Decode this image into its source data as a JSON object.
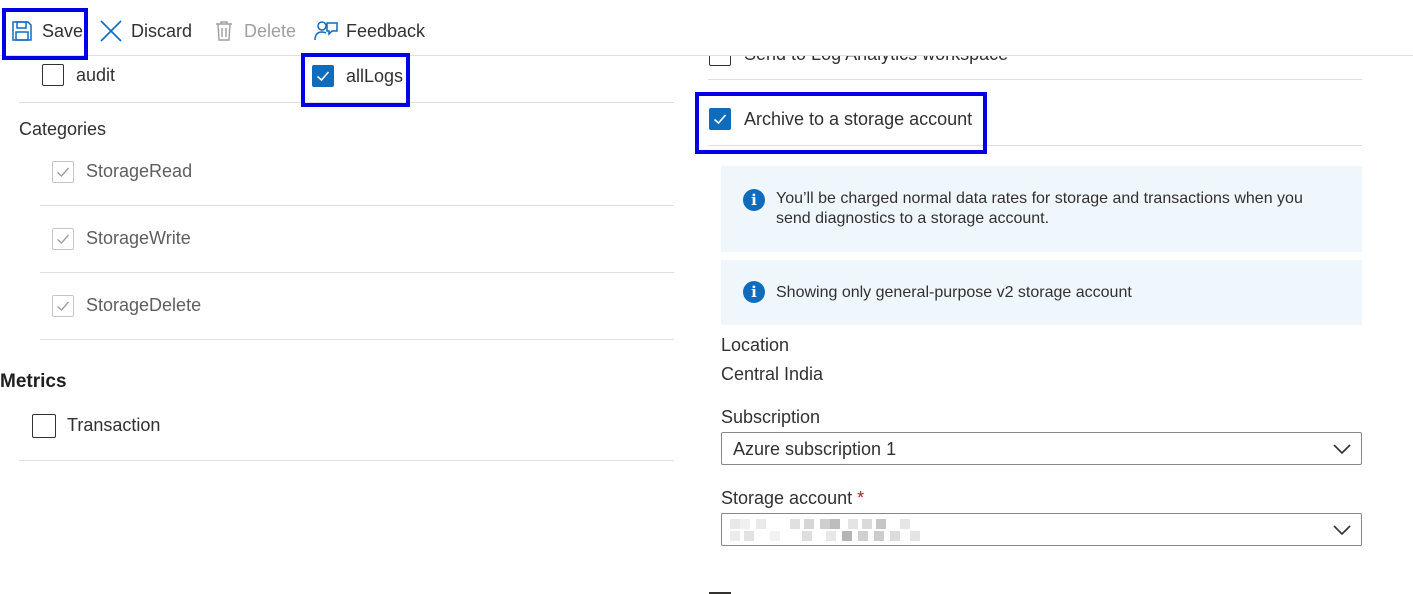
{
  "toolbar": {
    "save_label": "Save",
    "discard_label": "Discard",
    "delete_label": "Delete",
    "feedback_label": "Feedback"
  },
  "logs": {
    "categorygroups": [
      {
        "label": "audit",
        "checked": false
      },
      {
        "label": "allLogs",
        "checked": true
      }
    ],
    "categories_title": "Categories",
    "categories": [
      {
        "label": "StorageRead",
        "checked": true,
        "disabled": true
      },
      {
        "label": "StorageWrite",
        "checked": true,
        "disabled": true
      },
      {
        "label": "StorageDelete",
        "checked": true,
        "disabled": true
      }
    ]
  },
  "metrics": {
    "title": "Metrics",
    "items": [
      {
        "label": "Transaction",
        "checked": false
      }
    ]
  },
  "destinations": {
    "log_analytics_label": "Send to Log Analytics workspace",
    "archive_label": "Archive to a storage account",
    "info_charge": "You’ll be charged normal data rates for storage and transactions when you send diagnostics to a storage account.",
    "info_general_purpose": "Showing only general-purpose v2 storage account",
    "location_label": "Location",
    "location_value": "Central India",
    "subscription_label": "Subscription",
    "subscription_value": "Azure subscription 1",
    "storage_account_label": "Storage account",
    "required_marker": "*"
  },
  "icons": {
    "save": "save-icon",
    "discard": "close-icon",
    "delete": "trash-icon",
    "feedback": "feedback-icon",
    "info": "info-icon",
    "chevron": "chevron-down-icon"
  },
  "colors": {
    "accent": "#0f6cbd",
    "highlight": "#0000e6",
    "info_bg": "#eff6fc",
    "required": "#a4262c"
  }
}
